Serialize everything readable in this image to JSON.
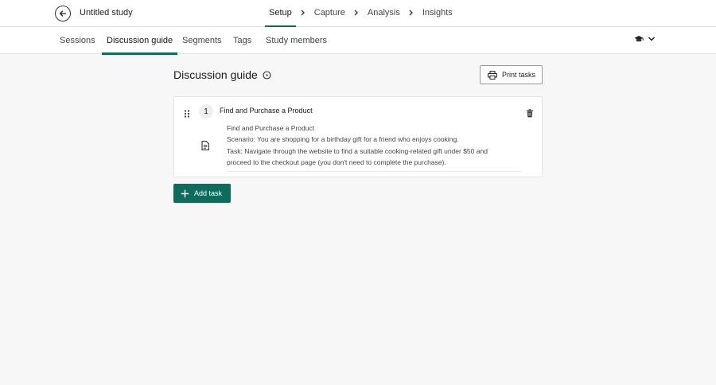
{
  "header": {
    "study_title": "Untitled study",
    "steps": [
      "Setup",
      "Capture",
      "Analysis",
      "Insights"
    ],
    "active_step": "Setup"
  },
  "tabs": [
    "Sessions",
    "Discussion guide",
    "Segments",
    "Tags",
    "Study members"
  ],
  "active_tab": "Discussion guide",
  "page": {
    "title": "Discussion guide",
    "print_button": "Print tasks",
    "add_button": "Add task"
  },
  "tasks": [
    {
      "number": "1",
      "title": "Find and Purchase a Product",
      "body_lines": [
        "Find and Purchase a Product",
        "Scenario: You are shopping for a birthday gift for a friend who enjoys cooking.",
        "Task: Navigate through the website to find a suitable cooking-related gift under $50 and",
        "proceed to the checkout page (you don't need to complete the purchase)."
      ]
    }
  ],
  "icons": {
    "back": "arrow-left-icon",
    "step_separator": "chevron-right-icon",
    "help": "graduation-cap-icon",
    "menu": "chevron-down-icon",
    "info": "info-circle-icon",
    "print": "printer-icon",
    "drag": "drag-handle-icon",
    "delete": "trash-icon",
    "document": "document-icon",
    "add": "plus-icon"
  },
  "colors": {
    "accent": "#0f6b5c",
    "background": "#f7f7f7"
  }
}
